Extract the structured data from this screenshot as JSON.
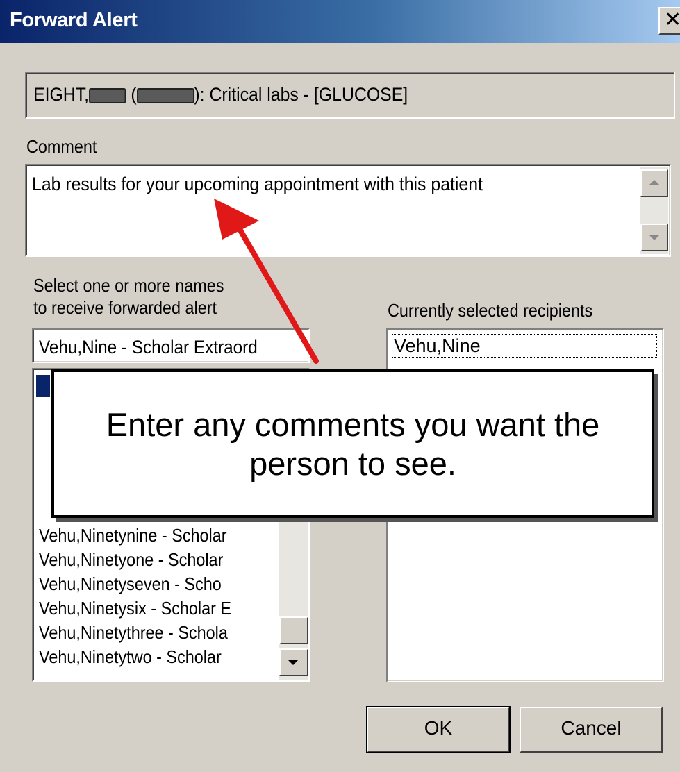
{
  "window": {
    "title": "Forward Alert",
    "close_glyph": "✕"
  },
  "alert": {
    "text_prefix": "EIGHT,",
    "text_suffix": "): Critical labs - [GLUCOSE]"
  },
  "comment": {
    "label": "Comment",
    "value": "Lab results for your upcoming appointment with this patient"
  },
  "names": {
    "label_line1": "Select one or more names",
    "label_line2": "to receive forwarded alert",
    "search_value": "Vehu,Nine - Scholar Extraord",
    "items": [
      "Vehu,Ninetynine - Scholar",
      "Vehu,Ninetyone - Scholar",
      "Vehu,Ninetyseven - Scho",
      "Vehu,Ninetysix - Scholar E",
      "Vehu,Ninetythree - Schola",
      "Vehu,Ninetytwo - Scholar"
    ]
  },
  "recipients": {
    "label": "Currently selected recipients",
    "items": [
      "Vehu,Nine"
    ]
  },
  "buttons": {
    "ok": "OK",
    "cancel": "Cancel"
  },
  "callout": {
    "text": "Enter any comments you want the person to see."
  },
  "colors": {
    "dialog_bg": "#d4d0c8",
    "title_gradient_start": "#0a246a",
    "arrow": "#e01818",
    "selection": "#0a246a"
  }
}
